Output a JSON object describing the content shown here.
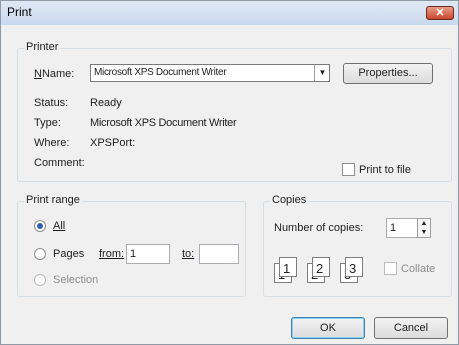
{
  "window": {
    "title": "Print",
    "close_label": "✕"
  },
  "printer": {
    "legend": "Printer",
    "name_label": "Name:",
    "name_value": "Microsoft XPS Document Writer",
    "properties_label": "Properties...",
    "status_label": "Status:",
    "status_value": "Ready",
    "type_label": "Type:",
    "type_value": "Microsoft XPS Document Writer",
    "where_label": "Where:",
    "where_value": "XPSPort:",
    "comment_label": "Comment:",
    "print_to_file_label": "Print to file"
  },
  "print_range": {
    "legend": "Print range",
    "all_label": "All",
    "pages_label": "Pages",
    "from_label": "from:",
    "from_value": "1",
    "to_label": "to:",
    "to_value": "",
    "selection_label": "Selection"
  },
  "copies": {
    "legend": "Copies",
    "number_label": "Number of copies:",
    "number_value": "1",
    "collate_label": "Collate"
  },
  "buttons": {
    "ok_label": "OK",
    "cancel_label": "Cancel"
  }
}
